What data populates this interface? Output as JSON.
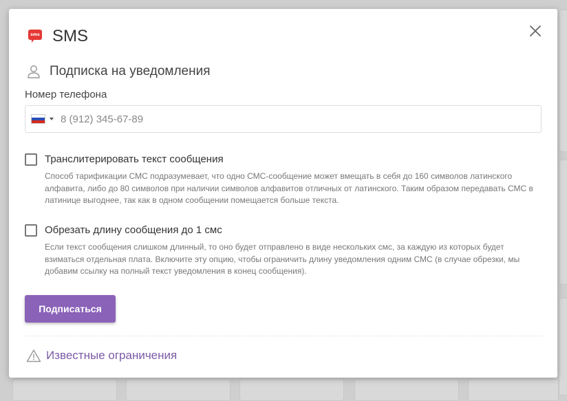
{
  "modal": {
    "title": "SMS",
    "icon_text": "sms",
    "accent_color": "#8a62b8",
    "icon_color": "#e53935"
  },
  "subscription": {
    "section_title": "Подписка на уведомления",
    "phone_label": "Номер телефона",
    "phone_placeholder": "8 (912) 345-67-89",
    "country_flag": "russia-flag"
  },
  "options": [
    {
      "label": "Транслитерировать текст сообщения",
      "checked": false,
      "description": "Способ тарификации СМС подразумевает, что одно СМС-сообщение может вмещать в себя до 160 символов латинского алфавита, либо до 80 символов при наличии символов алфавитов отличных от латинского. Таким образом передавать СМС в латинице выгоднее, так как в одном сообщении помещается больше текста."
    },
    {
      "label": "Обрезать длину сообщения до 1 смс",
      "checked": false,
      "description": "Если текст сообщения слишком длинный, то оно будет отправлено в виде нескольких смс, за каждую из которых будет взиматься отдельная плата. Включите эту опцию, чтобы ограничить длину уведомления одним СМС (в случае обрезки, мы добавим ссылку на полный текст уведомления в конец сообщения)."
    }
  ],
  "actions": {
    "subscribe_label": "Подписаться",
    "known_limits_label": "Известные ограничения"
  }
}
